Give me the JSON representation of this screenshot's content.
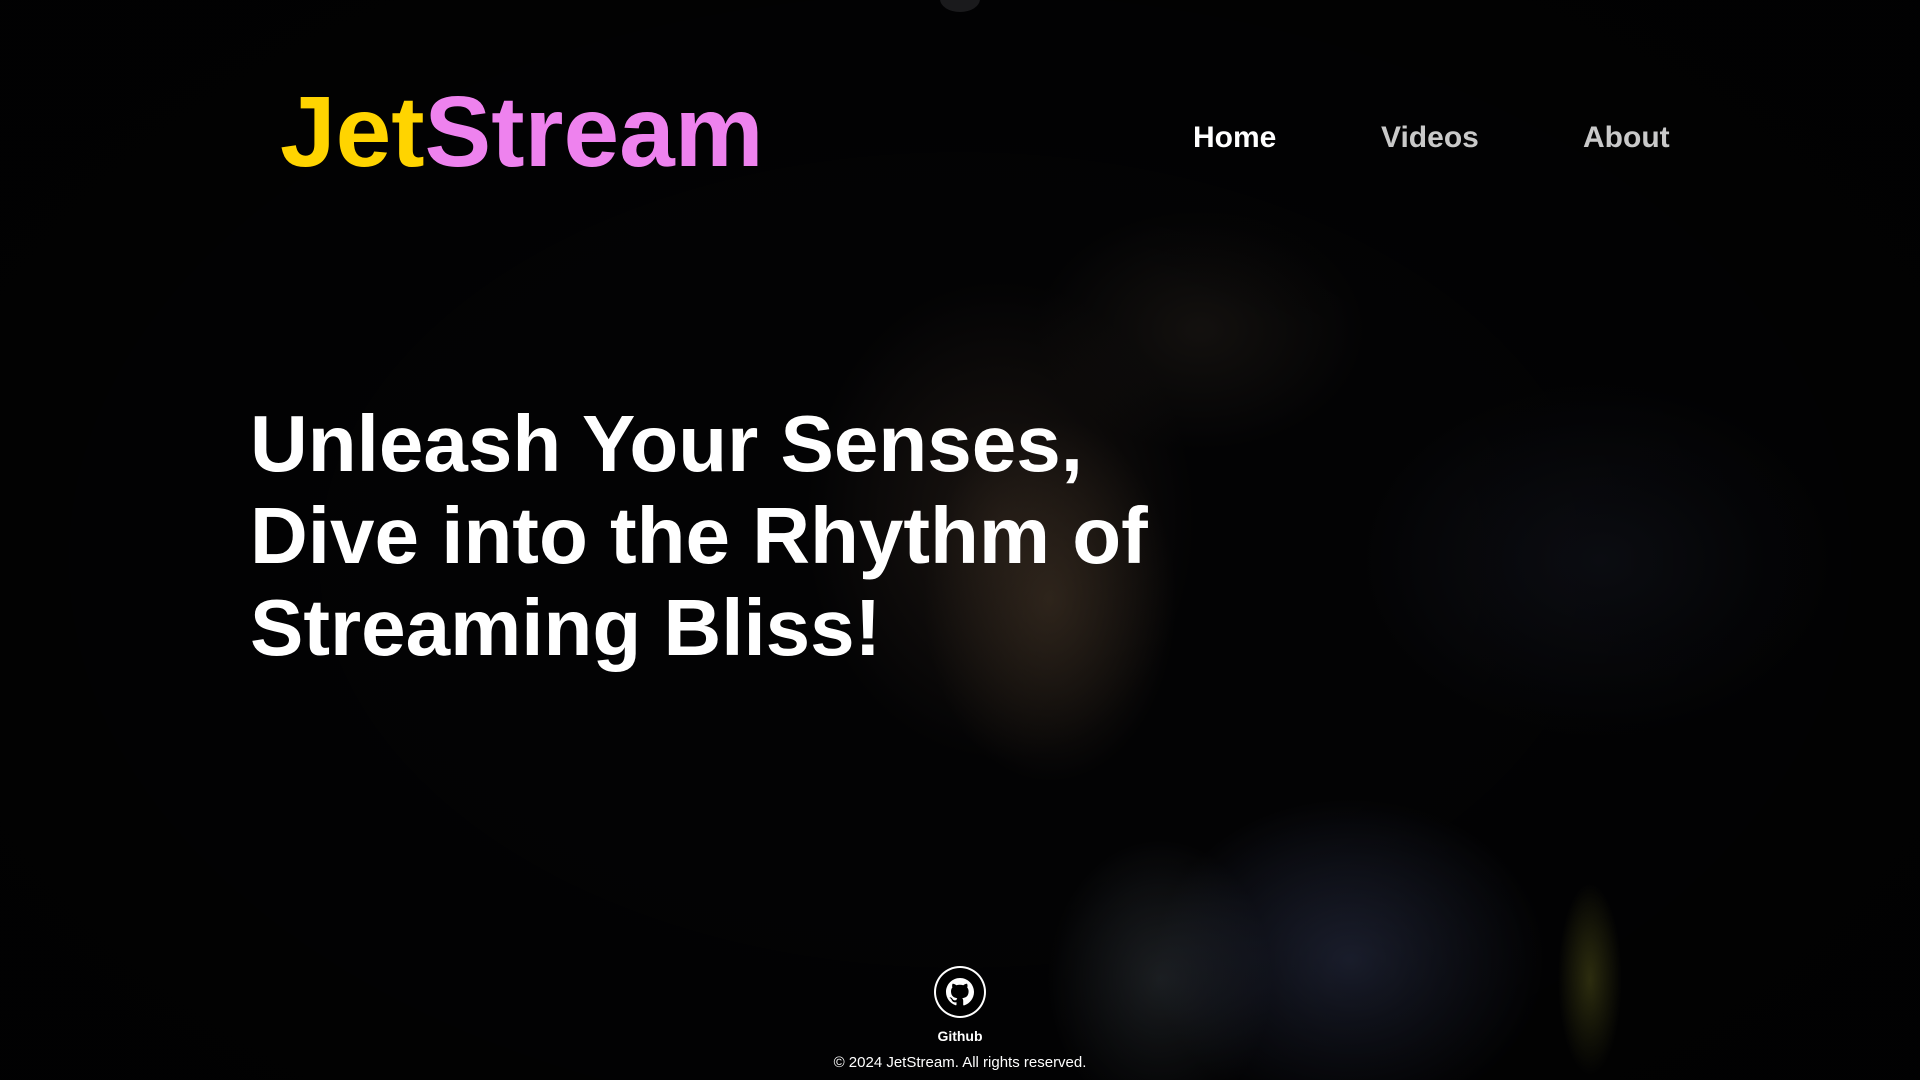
{
  "brand": {
    "part1": "Jet",
    "part2": "Stream",
    "part1_color": "#FFD400",
    "part2_color": "#EE82EE"
  },
  "nav": {
    "items": [
      {
        "label": "Home",
        "active": true
      },
      {
        "label": "Videos",
        "active": false
      },
      {
        "label": "About",
        "active": false
      }
    ]
  },
  "hero": {
    "line1": "Unleash Your Senses,",
    "line2": "Dive into the Rhythm of",
    "line3": "Streaming Bliss!"
  },
  "footer": {
    "github_icon": "github-icon",
    "github_label": "Github",
    "copyright": "© 2024 JetStream. All rights reserved."
  }
}
